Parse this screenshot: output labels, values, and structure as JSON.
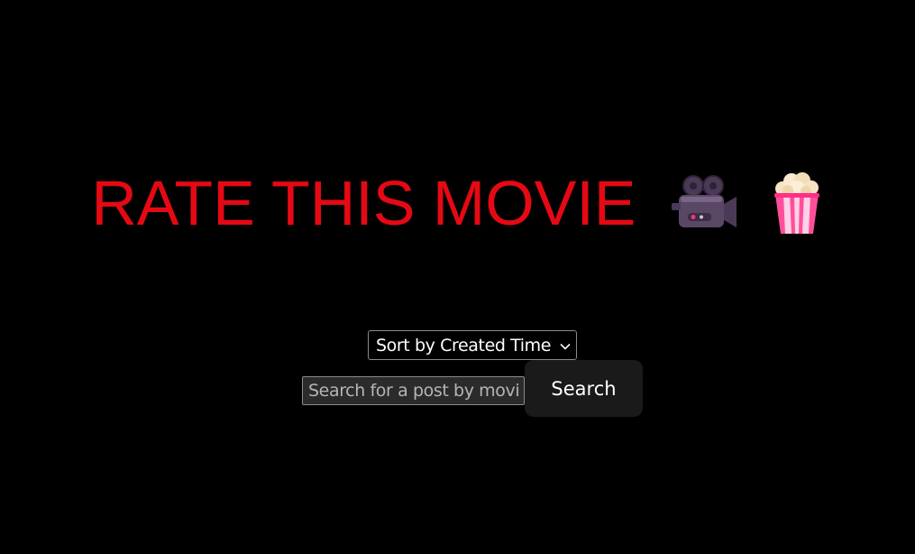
{
  "header": {
    "title": "RATE THIS MOVIE",
    "title_color": "#e50914",
    "icons": [
      "movie-camera-icon",
      "popcorn-icon"
    ]
  },
  "sort": {
    "selected": "Sort by Created Time"
  },
  "search": {
    "placeholder": "Search for a post by movie title",
    "button_label": "Search"
  },
  "colors": {
    "background": "#000000",
    "button_bg": "#1a1a1a"
  }
}
